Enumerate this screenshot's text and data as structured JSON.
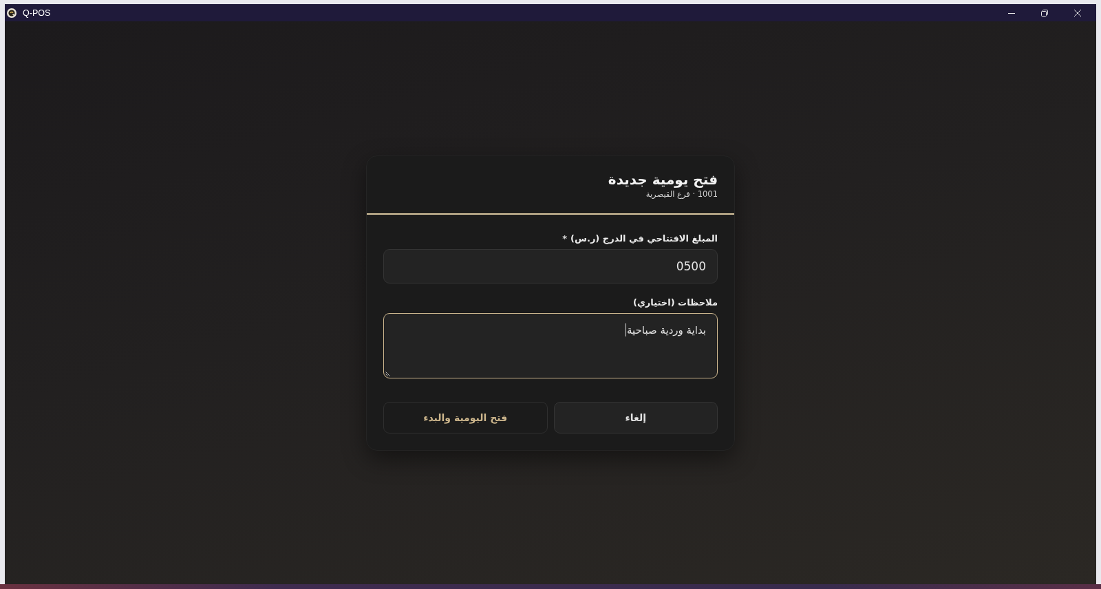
{
  "window": {
    "title": "Q-POS"
  },
  "dialog": {
    "title": "فتح يومية جديدة",
    "subtitle": "1001 · فرع القيصرية",
    "fields": [
      {
        "kind": "input",
        "label": "المبلغ الافتتاحي في الدرج (ر.س)",
        "required_mark": "*",
        "value": "0500",
        "focused": false
      },
      {
        "kind": "textarea",
        "label": "ملاحظات (اختياري)",
        "value": "بداية وردية صباحية",
        "focused": true
      }
    ],
    "buttons": [
      {
        "label": "إلغاء",
        "kind": "secondary"
      },
      {
        "label": "فتح اليومية والبدء",
        "kind": "primary"
      }
    ]
  }
}
